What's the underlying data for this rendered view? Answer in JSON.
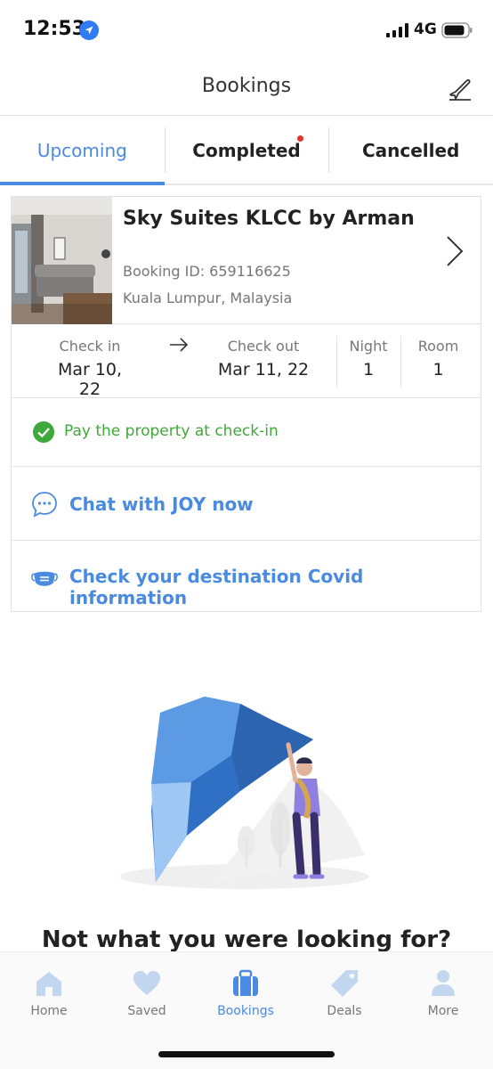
{
  "status": {
    "time": "12:53",
    "network": "4G"
  },
  "header": {
    "title": "Bookings"
  },
  "tabs": [
    {
      "label": "Upcoming",
      "active": true
    },
    {
      "label": "Completed",
      "active": false,
      "has_dot": true
    },
    {
      "label": "Cancelled",
      "active": false
    }
  ],
  "booking": {
    "hotel_name": "Sky Suites KLCC by Arman",
    "booking_id": "Booking ID: 659116625",
    "location": "Kuala Lumpur, Malaysia",
    "check_in_label": "Check in",
    "check_in_value": "Mar 10, 22",
    "check_out_label": "Check out",
    "check_out_value": "Mar 11, 22",
    "night_label": "Night",
    "night_value": "1",
    "room_label": "Room",
    "room_value": "1",
    "payment_note": "Pay the property at check-in",
    "chat_link": "Chat with JOY now",
    "covid_link": "Check your destination Covid information"
  },
  "empty_heading": "Not what you were looking for?",
  "tabbar": [
    {
      "label": "Home",
      "icon": "home-icon"
    },
    {
      "label": "Saved",
      "icon": "heart-icon"
    },
    {
      "label": "Bookings",
      "icon": "suitcase-icon",
      "active": true
    },
    {
      "label": "Deals",
      "icon": "tag-icon"
    },
    {
      "label": "More",
      "icon": "person-icon"
    }
  ],
  "colors": {
    "accent": "#4a8ae0",
    "success": "#3ea83a",
    "dot": "#e0342a"
  }
}
